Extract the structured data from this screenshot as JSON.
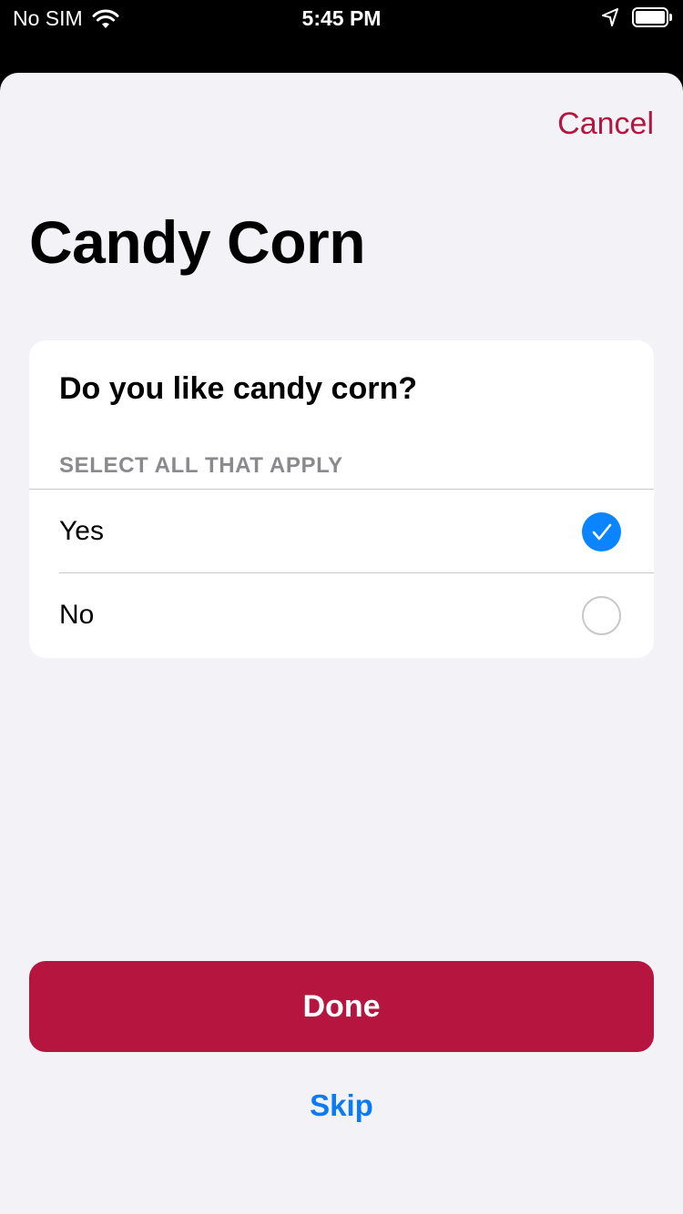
{
  "status_bar": {
    "carrier": "No SIM",
    "time": "5:45 PM",
    "wifi_icon": "wifi-icon",
    "location_icon": "location-arrow-icon",
    "battery_icon": "battery-icon"
  },
  "header": {
    "cancel_label": "Cancel",
    "title": "Candy Corn"
  },
  "question_card": {
    "question": "Do you like candy corn?",
    "instruction": "SELECT ALL THAT APPLY",
    "options": [
      {
        "label": "Yes",
        "selected": true
      },
      {
        "label": "No",
        "selected": false
      }
    ]
  },
  "footer": {
    "done_label": "Done",
    "skip_label": "Skip"
  },
  "colors": {
    "accent": "#b5153f",
    "link": "#0a7bf5",
    "checkmark": "#0a84ff",
    "background": "#f2f2f7"
  }
}
